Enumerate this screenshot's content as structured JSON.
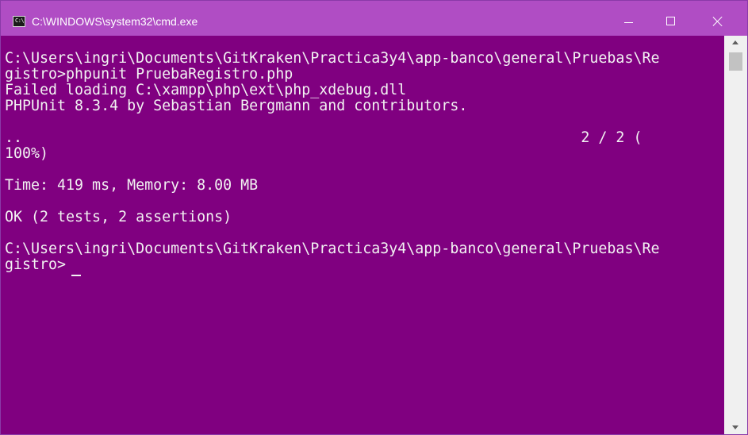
{
  "window": {
    "title": "C:\\WINDOWS\\system32\\cmd.exe",
    "icon": "console-icon",
    "icon_glyph": "C:\\",
    "titlebar_color": "#b04dc4",
    "background_color": "#800080",
    "text_color": "#f2f2f2"
  },
  "controls": {
    "minimize": "minimize-icon",
    "maximize": "maximize-icon",
    "close": "close-icon"
  },
  "console": {
    "lines": [
      "C:\\Users\\ingri\\Documents\\GitKraken\\Practica3y4\\app-banco\\general\\Pruebas\\Re",
      "gistro>phpunit PruebaRegistro.php",
      "Failed loading C:\\xampp\\php\\ext\\php_xdebug.dll",
      "PHPUnit 8.3.4 by Sebastian Bergmann and contributors.",
      "",
      "..                                                                2 / 2 (",
      "100%)",
      "",
      "Time: 419 ms, Memory: 8.00 MB",
      "",
      "OK (2 tests, 2 assertions)",
      "",
      "C:\\Users\\ingri\\Documents\\GitKraken\\Practica3y4\\app-banco\\general\\Pruebas\\Re",
      "gistro>"
    ]
  },
  "scrollbar": {
    "up": "scroll-up-arrow-icon",
    "down": "scroll-down-arrow-icon"
  }
}
